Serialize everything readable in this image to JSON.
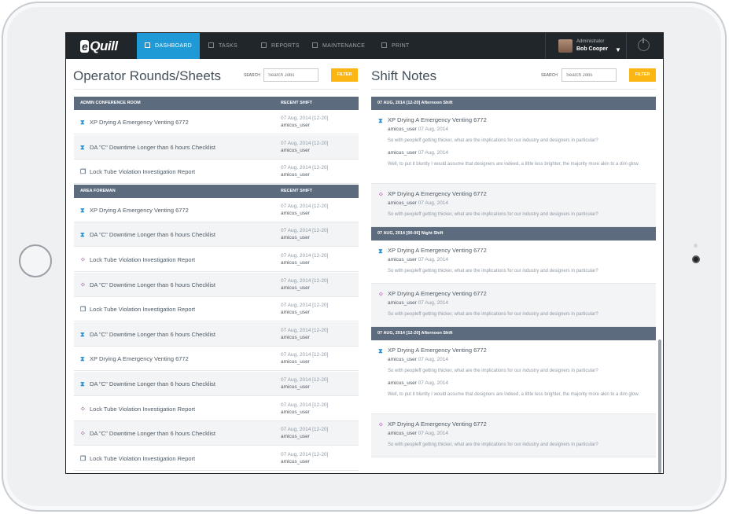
{
  "nav": {
    "logo": "Quill",
    "logo_e": "e",
    "items": [
      {
        "label": "DASHBOARD"
      },
      {
        "label": "TASKS"
      },
      {
        "label": "REPORTS"
      },
      {
        "label": "MAINTENANCE"
      },
      {
        "label": "PRINT"
      }
    ],
    "user_role": "Administrator",
    "user_name": "Bob Cooper"
  },
  "left": {
    "title": "Operator Rounds/Sheets",
    "search_label": "SEARCH",
    "search_placeholder": "Search Jobs",
    "filter_label": "FILTER",
    "sections": [
      {
        "header": "ADMIN CONFERENCE ROOM",
        "col2": "RECENT SHIFT",
        "rows": [
          {
            "icon": "hourglass-icon",
            "title": "XP Drying A Emergency Venting 6772",
            "date": "07 Aug, 2014 [12-20]",
            "user": "amicus_user"
          },
          {
            "icon": "hourglass-icon",
            "title": "DA \"C\" Downtime Longer than 6 hours Checklist",
            "date": "07 Aug, 2014 [12-20]",
            "user": "amicus_user"
          },
          {
            "icon": "document-icon",
            "title": "Lock Tube Violation Investigation Report",
            "date": "07 Aug, 2014 [12-20]",
            "user": "amicus_user"
          }
        ]
      },
      {
        "header": "AREA FOREMAN",
        "col2": "RECENT SHIFT",
        "rows": [
          {
            "icon": "hourglass-icon",
            "title": "XP Drying A Emergency Venting 6772",
            "date": "07 Aug, 2014 [12-20]",
            "user": "amicus_user"
          },
          {
            "icon": "hourglass-icon",
            "title": "DA \"C\" Downtime Longer than 6 hours Checklist",
            "date": "07 Aug, 2014 [12-20]",
            "user": "amicus_user"
          },
          {
            "icon": "grid-icon",
            "title": "Lock Tube Violation Investigation Report",
            "date": "07 Aug, 2014 [12-20]",
            "user": "amicus_user"
          },
          {
            "icon": "grid-icon",
            "title": "DA \"C\" Downtime Longer than 6 hours Checklist",
            "date": "07 Aug, 2014 [12-20]",
            "user": "amicus_user"
          },
          {
            "icon": "document-icon",
            "title": "Lock Tube Violation Investigation Report",
            "date": "07 Aug, 2014 [12-20]",
            "user": "amicus_user"
          },
          {
            "icon": "hourglass-icon",
            "title": "DA \"C\" Downtime Longer than 6 hours Checklist",
            "date": "07 Aug, 2014 [12-20]",
            "user": "amicus_user"
          },
          {
            "icon": "hourglass-icon",
            "title": "XP Drying A Emergency Venting 6772",
            "date": "07 Aug, 2014 [12-20]",
            "user": "amicus_user"
          },
          {
            "icon": "hourglass-icon",
            "title": "DA \"C\" Downtime Longer than 6 hours Checklist",
            "date": "07 Aug, 2014 [12-20]",
            "user": "amicus_user"
          },
          {
            "icon": "grid-icon",
            "title": "Lock Tube Violation Investigation Report",
            "date": "07 Aug, 2014 [12-20]",
            "user": "amicus_user"
          },
          {
            "icon": "grid-icon",
            "title": "DA \"C\" Downtime Longer than 6 hours Checklist",
            "date": "07 Aug, 2014 [12-20]",
            "user": "amicus_user"
          },
          {
            "icon": "document-icon",
            "title": "Lock Tube Violation Investigation Report",
            "date": "07 Aug, 2014 [12-20]",
            "user": "amicus_user"
          }
        ]
      }
    ]
  },
  "right": {
    "title": "Shift Notes",
    "search_label": "SEARCH",
    "search_placeholder": "Search Jobs",
    "filter_label": "FILTER",
    "groups": [
      {
        "header": "07 AUG, 2014 [12-20] Afternoon Shift",
        "notes": [
          {
            "icon": "hourglass-icon",
            "title": "XP Drying A Emergency Venting 6772",
            "comments": [
              {
                "user": "amicus_user",
                "date": "07 Aug, 2014",
                "text": "So with peopleff getting thicker, what are the implications for our industry and designers in particular?"
              },
              {
                "user": "amicus_user",
                "date": "07 Aug, 2014",
                "text": "Well, to put it bluntly I would assume that designers are indeed, a little less brighter, the majority more akin to a dim glow."
              }
            ]
          },
          {
            "icon": "grid-icon",
            "title": "XP Drying A Emergency Venting 6772",
            "comments": [
              {
                "user": "amicus_user",
                "date": "07 Aug, 2014",
                "text": "So with peopleff getting thicker, what are the implications for our industry and designers in particular?"
              }
            ]
          }
        ]
      },
      {
        "header": "07 AUG, 2014 [00-06] Night Shift",
        "notes": [
          {
            "icon": "hourglass-icon",
            "title": "XP Drying A Emergency Venting 6772",
            "comments": [
              {
                "user": "amicus_user",
                "date": "07 Aug, 2014",
                "text": "So with peopleff getting thicker, what are the implications for our industry and designers in particular?"
              }
            ]
          },
          {
            "icon": "grid-icon",
            "title": "XP Drying A Emergency Venting 6772",
            "comments": [
              {
                "user": "amicus_user",
                "date": "07 Aug, 2014",
                "text": "So with peopleff getting thicker, what are the implications for our industry and designers in particular?"
              }
            ]
          }
        ]
      },
      {
        "header": "07 AUG, 2014 [12-20] Afternoon Shift",
        "notes": [
          {
            "icon": "hourglass-icon",
            "title": "XP Drying A Emergency Venting 6772",
            "comments": [
              {
                "user": "amicus_user",
                "date": "07 Aug, 2014",
                "text": "So with peopleff getting thicker, what are the implications for our industry and designers in particular?"
              },
              {
                "user": "amicus_user",
                "date": "07 Aug, 2014",
                "text": "Well, to put it bluntly I would assume that designers are indeed, a little less brighter, the majority more akin to a dim glow."
              }
            ]
          },
          {
            "icon": "grid-icon",
            "title": "XP Drying A Emergency Venting 6772",
            "comments": [
              {
                "user": "amicus_user",
                "date": "07 Aug, 2014",
                "text": "So with peopleff getting thicker, what are the implications for our industry and designers in particular?"
              }
            ]
          }
        ]
      }
    ]
  },
  "colors": {
    "nav_bg": "#21262b",
    "active_tab": "#1f9ad6",
    "header_bar": "#5c6b7e",
    "filter_button": "#fcb614",
    "icon_blue": "#2b8fd1",
    "icon_purple": "#9b2f9a"
  }
}
